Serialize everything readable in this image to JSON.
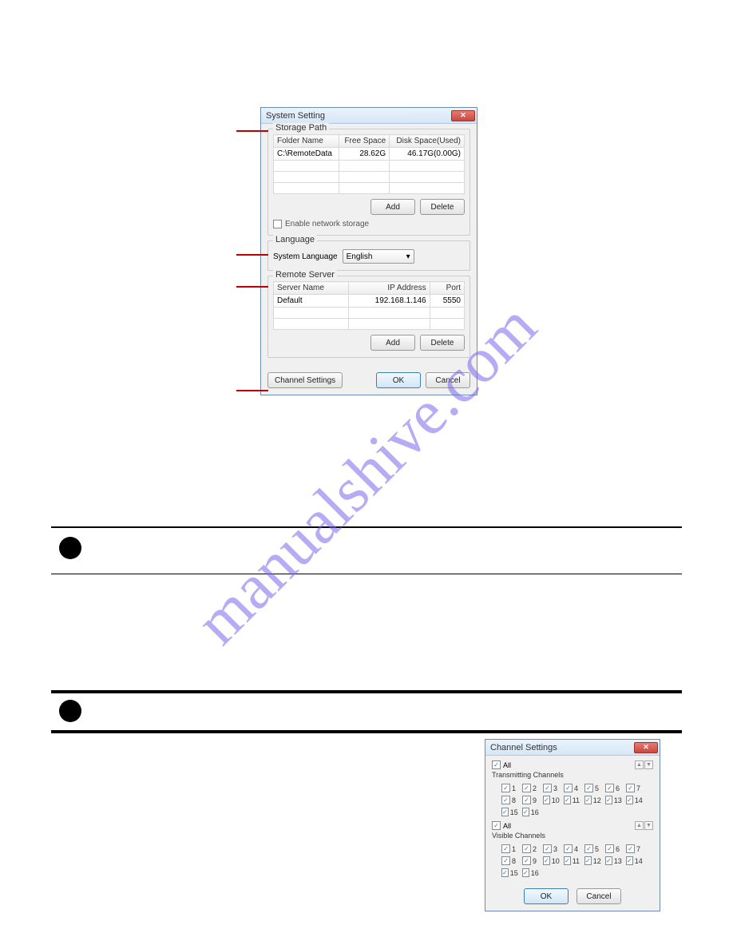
{
  "watermark": "manualshive.com",
  "dialog1": {
    "title": "System Setting",
    "close_icon": "✕",
    "sections": {
      "storage": {
        "legend": "Storage Path",
        "columns": {
          "folder": "Folder Name",
          "free": "Free Space",
          "disk": "Disk Space(Used)"
        },
        "rows": [
          {
            "folder": "C:\\RemoteData",
            "free": "28.62G",
            "disk": "46.17G(0.00G)"
          }
        ],
        "add_btn": "Add",
        "delete_btn": "Delete",
        "enable_network_label": "Enable network storage"
      },
      "language": {
        "legend": "Language",
        "label": "System Language",
        "value": "English"
      },
      "remote": {
        "legend": "Remote Server",
        "columns": {
          "name": "Server Name",
          "ip": "IP Address",
          "port": "Port"
        },
        "rows": [
          {
            "name": "Default",
            "ip": "192.168.1.146",
            "port": "5550"
          }
        ],
        "add_btn": "Add",
        "delete_btn": "Delete"
      }
    },
    "footer": {
      "channel_btn": "Channel Settings",
      "ok_btn": "OK",
      "cancel_btn": "Cancel"
    }
  },
  "dialog2": {
    "title": "Channel Settings",
    "close_icon": "✕",
    "all_label": "All",
    "transmitting_label": "Transmitting Channels",
    "visible_label": "Visible Channels",
    "channels": [
      "1",
      "2",
      "3",
      "4",
      "5",
      "6",
      "7",
      "8",
      "9",
      "10",
      "11",
      "12",
      "13",
      "14",
      "15",
      "16"
    ],
    "ok_btn": "OK",
    "cancel_btn": "Cancel",
    "check_glyph": "✓",
    "stepper_up": "▲",
    "stepper_dn": "▼"
  }
}
